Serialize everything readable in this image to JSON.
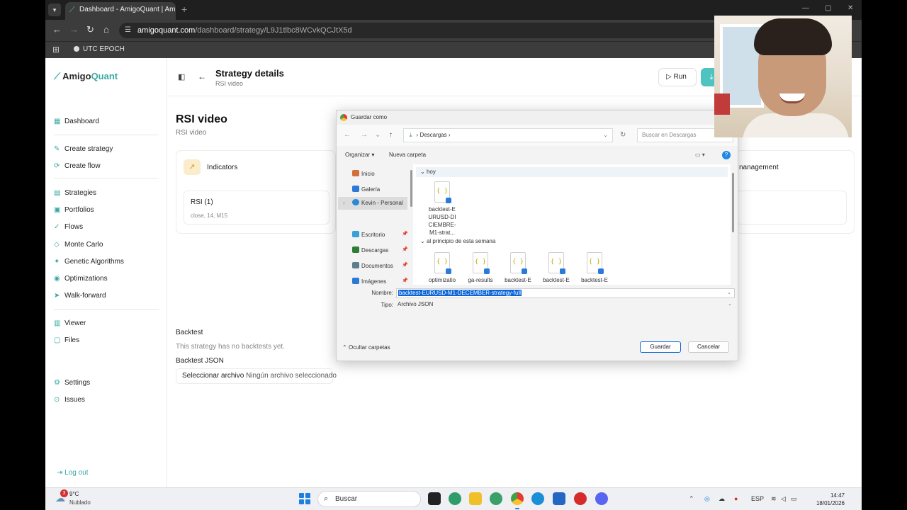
{
  "browser": {
    "tab_title": "Dashboard - AmigoQuant | Am",
    "tab_close": "×",
    "new_tab": "+",
    "url_host": "amigoquant.com",
    "url_path": "/dashboard/strategy/L9J1tlbc8WCvkQCJtX5d",
    "bookmark": "UTC EPOCH"
  },
  "brand": {
    "name_a": "Amigo",
    "name_b": "Quant"
  },
  "sidebar": {
    "items": [
      {
        "label": "Dashboard",
        "icon": "grid-icon",
        "glyph": "▦"
      },
      {
        "label": "Create strategy",
        "icon": "wand-icon",
        "glyph": "✎"
      },
      {
        "label": "Create flow",
        "icon": "flow-icon",
        "glyph": "⟳"
      },
      {
        "label": "Strategies",
        "icon": "chart-icon",
        "glyph": "▤"
      },
      {
        "label": "Portfolios",
        "icon": "briefcase-icon",
        "glyph": "▣"
      },
      {
        "label": "Flows",
        "icon": "flows-icon",
        "glyph": "✓"
      },
      {
        "label": "Monte Carlo",
        "icon": "dice-icon",
        "glyph": "◇"
      },
      {
        "label": "Genetic Algorithms",
        "icon": "dna-icon",
        "glyph": "✦"
      },
      {
        "label": "Optimizations",
        "icon": "tune-icon",
        "glyph": "◉"
      },
      {
        "label": "Walk-forward",
        "icon": "walk-icon",
        "glyph": "➤"
      },
      {
        "label": "Viewer",
        "icon": "viewer-icon",
        "glyph": "▥"
      },
      {
        "label": "Files",
        "icon": "file-icon",
        "glyph": "▢"
      },
      {
        "label": "Settings",
        "icon": "gear-icon",
        "glyph": "⚙"
      },
      {
        "label": "Issues",
        "icon": "alert-icon",
        "glyph": "⊙"
      }
    ],
    "logout": "Log out"
  },
  "header": {
    "title": "Strategy details",
    "subtitle": "RSI video",
    "run_label": "Run"
  },
  "strategy": {
    "name": "RSI video",
    "description": "RSI video",
    "indicators_label": "Indicators",
    "indicator": {
      "name": "RSI (1)",
      "params": "close, 14, M15"
    },
    "management_label": "nanagement",
    "backtest_title": "Backtest",
    "backtest_empty": "This strategy has no backtests yet.",
    "backtest_json_label": "Backtest JSON",
    "file_button": "Seleccionar archivo",
    "file_none": "Ningún archivo seleccionado"
  },
  "dialog": {
    "title": "Guardar como",
    "path": "Descargas",
    "search_placeholder": "Buscar en Descargas",
    "organize": "Organizar ▾",
    "new_folder": "Nueva carpeta",
    "left_nav": [
      {
        "label": "Inicio",
        "color": "#d0703a"
      },
      {
        "label": "Galería",
        "color": "#2b7bd6"
      },
      {
        "label": "Kevin - Personal",
        "color": "#2b88d8"
      },
      {
        "label": "Escritorio",
        "color": "#3aa0d8"
      },
      {
        "label": "Descargas",
        "color": "#2e7d32"
      },
      {
        "label": "Documentos",
        "color": "#607d8b"
      },
      {
        "label": "Imágenes",
        "color": "#2b7bd6"
      }
    ],
    "group_today": "hoy",
    "group_week": "al principio de esta semana",
    "today_file": [
      "backtest-E",
      "URUSD-DI",
      "CIEMBRE-",
      "M1-strat..."
    ],
    "week_files": [
      "optimizatio",
      "ga-results",
      "backtest-E",
      "backtest-E",
      "backtest-E"
    ],
    "file_glyph": "{ }",
    "name_label": "Nombre:",
    "name_value": "backtest-EURUSD-M1-DECEMBER-strategy-full",
    "type_label": "Tipo:",
    "type_value": "Archivo JSON",
    "hide_folders": "Ocultar carpetas",
    "save_button": "Guardar",
    "cancel_button": "Cancelar"
  },
  "taskbar": {
    "weather_badge": "3",
    "temp": "9°C",
    "weather": "Nublado",
    "search": "Buscar",
    "lang": "ESP",
    "time": "14:47",
    "date": "18/01/2026"
  }
}
